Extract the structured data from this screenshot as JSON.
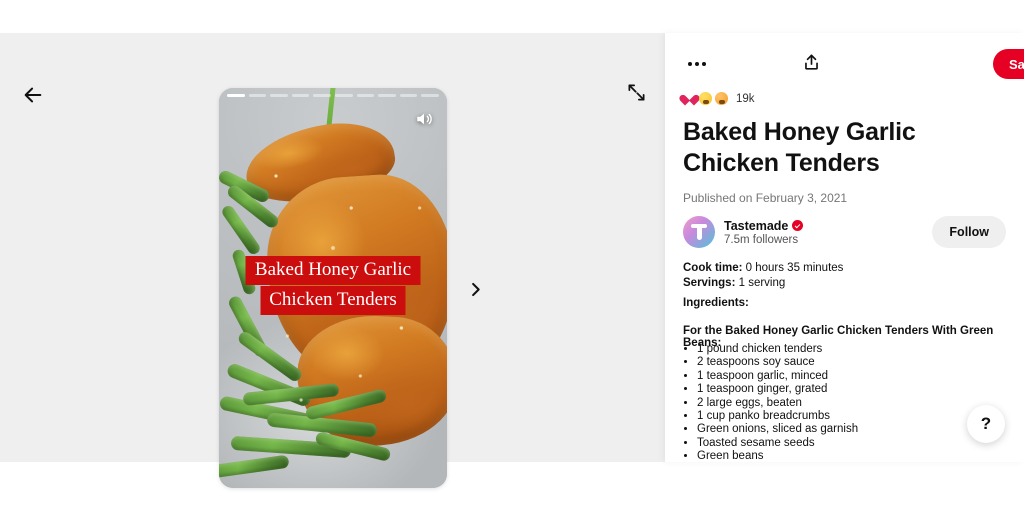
{
  "viewer": {
    "back_label": "Back",
    "expand_label": "Expand",
    "next_label": "Next",
    "sound_label": "Sound on",
    "progress_total": 10,
    "progress_active_index": 0,
    "caption_line1": "Baked Honey Garlic",
    "caption_line2": "Chicken Tenders",
    "background_color": "#efefef"
  },
  "detail": {
    "more_label": "More options",
    "share_label": "Share",
    "save_label": "Save",
    "save_color": "#e60023",
    "reactions": {
      "count": "19k",
      "emojis": [
        "heart",
        "yellow-face",
        "orange-face"
      ]
    },
    "title": "Baked Honey Garlic Chicken Tenders",
    "published": "Published on February 3, 2021",
    "author": {
      "name": "Tastemade",
      "verified": true,
      "followers": "7.5m followers",
      "follow_label": "Follow"
    },
    "meta": {
      "cook_time_label": "Cook time:",
      "cook_time_value": " 0 hours 35 minutes",
      "servings_label": "Servings:",
      "servings_value": " 1 serving"
    },
    "ingredients_heading": "Ingredients:",
    "ingredients_subheading": "For the Baked Honey Garlic Chicken Tenders With Green Beans:",
    "ingredients": [
      "1 pound chicken tenders",
      "2 teaspoons soy sauce",
      "1 teaspoon garlic, minced",
      "1 teaspoon ginger, grated",
      "2 large eggs, beaten",
      "1 cup panko breadcrumbs",
      "Green onions, sliced as garnish",
      "Toasted sesame seeds",
      "Green beans"
    ]
  },
  "help": {
    "label": "?"
  }
}
